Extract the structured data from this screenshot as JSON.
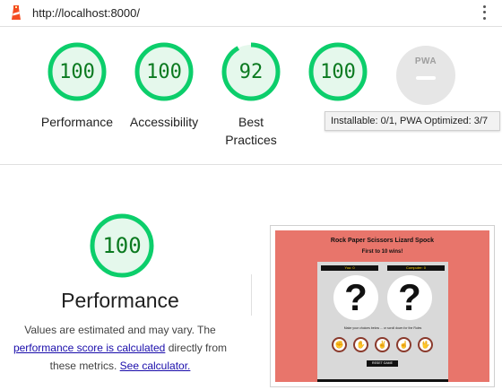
{
  "browser": {
    "url": "http://localhost:8000/"
  },
  "colors": {
    "pass": "#0cce6b",
    "pass_text": "#0b7a20",
    "pass_fill": "#e5f8ec",
    "pwa_gray": "#e6e6e6",
    "thumb_bg": "#e8756b"
  },
  "gauges": [
    {
      "score": "100",
      "label": "Performance",
      "fraction": 1.0
    },
    {
      "score": "100",
      "label": "Accessibility",
      "fraction": 1.0
    },
    {
      "score": "92",
      "label": "Best Practices",
      "fraction": 0.92
    },
    {
      "score": "100",
      "label": "",
      "fraction": 1.0
    }
  ],
  "pwa": {
    "badge_text": "PWA",
    "tooltip": "Installable: 0/1, PWA Optimized: 3/7"
  },
  "performance": {
    "score": "100",
    "fraction": 1.0,
    "title": "Performance",
    "desc_prefix": "Values are estimated and may vary. The ",
    "link1": "performance score is calculated",
    "desc_mid": " directly from these metrics. ",
    "link2": "See calculator."
  },
  "thumbnail": {
    "title": "Rock Paper Scissors Lizard Spock",
    "subtitle": "First to 10 wins!",
    "you_label": "You: 0",
    "computer_label": "Computer: 0",
    "question": "?",
    "instructions": "Make your choices below ... or scroll down for the Rules",
    "reset_label": "RESET GAME"
  }
}
